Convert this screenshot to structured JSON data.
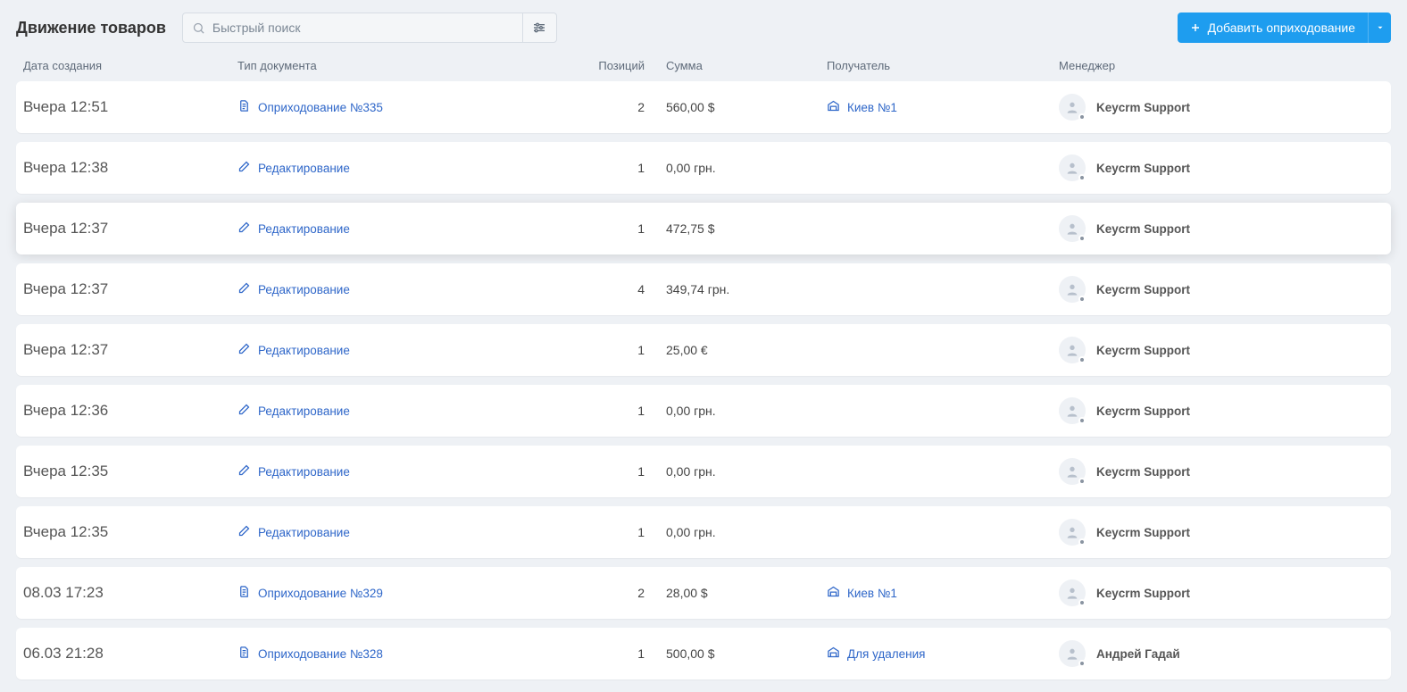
{
  "header": {
    "title": "Движение товаров",
    "search_placeholder": "Быстрый поиск",
    "add_button_label": "Добавить оприходование"
  },
  "columns": {
    "date": "Дата создания",
    "doc": "Тип документа",
    "pos": "Позиций",
    "sum": "Сумма",
    "rec": "Получатель",
    "mgr": "Менеджер"
  },
  "rows": [
    {
      "date": "Вчера 12:51",
      "doc_icon": "receipt",
      "doc": "Оприходование №335",
      "pos": "2",
      "sum": "560,00 $",
      "rec": "Киев №1",
      "mgr": "Keycrm Support",
      "highlight": false
    },
    {
      "date": "Вчера 12:38",
      "doc_icon": "edit",
      "doc": "Редактирование",
      "pos": "1",
      "sum": "0,00 грн.",
      "rec": "",
      "mgr": "Keycrm Support",
      "highlight": false
    },
    {
      "date": "Вчера 12:37",
      "doc_icon": "edit",
      "doc": "Редактирование",
      "pos": "1",
      "sum": "472,75 $",
      "rec": "",
      "mgr": "Keycrm Support",
      "highlight": true
    },
    {
      "date": "Вчера 12:37",
      "doc_icon": "edit",
      "doc": "Редактирование",
      "pos": "4",
      "sum": "349,74 грн.",
      "rec": "",
      "mgr": "Keycrm Support",
      "highlight": false
    },
    {
      "date": "Вчера 12:37",
      "doc_icon": "edit",
      "doc": "Редактирование",
      "pos": "1",
      "sum": "25,00 €",
      "rec": "",
      "mgr": "Keycrm Support",
      "highlight": false
    },
    {
      "date": "Вчера 12:36",
      "doc_icon": "edit",
      "doc": "Редактирование",
      "pos": "1",
      "sum": "0,00 грн.",
      "rec": "",
      "mgr": "Keycrm Support",
      "highlight": false
    },
    {
      "date": "Вчера 12:35",
      "doc_icon": "edit",
      "doc": "Редактирование",
      "pos": "1",
      "sum": "0,00 грн.",
      "rec": "",
      "mgr": "Keycrm Support",
      "highlight": false
    },
    {
      "date": "Вчера 12:35",
      "doc_icon": "edit",
      "doc": "Редактирование",
      "pos": "1",
      "sum": "0,00 грн.",
      "rec": "",
      "mgr": "Keycrm Support",
      "highlight": false
    },
    {
      "date": "08.03 17:23",
      "doc_icon": "receipt",
      "doc": "Оприходование №329",
      "pos": "2",
      "sum": "28,00 $",
      "rec": "Киев №1",
      "mgr": "Keycrm Support",
      "highlight": false
    },
    {
      "date": "06.03 21:28",
      "doc_icon": "receipt",
      "doc": "Оприходование №328",
      "pos": "1",
      "sum": "500,00 $",
      "rec": "Для удаления",
      "mgr": "Андрей Гадай",
      "highlight": false
    }
  ]
}
